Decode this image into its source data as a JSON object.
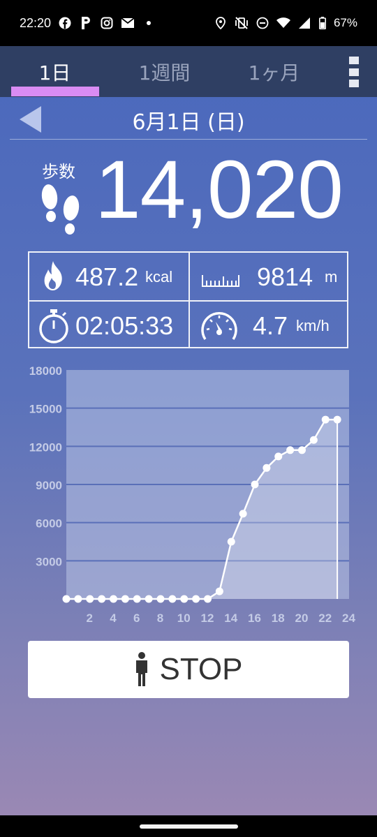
{
  "status_bar": {
    "time": "22:20",
    "battery": "67%",
    "left_icons": [
      "facebook-icon",
      "parking-icon",
      "instagram-icon",
      "mail-icon",
      "dot-icon"
    ],
    "right_icons": [
      "location-icon",
      "vibrate-off-icon",
      "dnd-icon",
      "wifi-icon",
      "signal-icon",
      "battery-icon"
    ]
  },
  "tabs": [
    {
      "label": "1日",
      "active": true
    },
    {
      "label": "1週間",
      "active": false
    },
    {
      "label": "1ヶ月",
      "active": false
    }
  ],
  "date_label": "6月1日 (日)",
  "steps": {
    "label": "歩数",
    "value": "14,020"
  },
  "stats": {
    "calories": {
      "value": "487.2",
      "unit": "kcal"
    },
    "distance": {
      "value": "9814",
      "unit": "m"
    },
    "time": {
      "value": "02:05:33"
    },
    "speed": {
      "value": "4.7",
      "unit": "km/h"
    }
  },
  "chart_data": {
    "type": "area",
    "title": "",
    "xlabel": "",
    "ylabel": "",
    "xlim": [
      0,
      24
    ],
    "ylim": [
      0,
      18000
    ],
    "x_ticks": [
      2,
      4,
      6,
      8,
      10,
      12,
      14,
      16,
      18,
      20,
      22,
      24
    ],
    "y_ticks": [
      3000,
      6000,
      9000,
      12000,
      15000,
      18000
    ],
    "grid": true,
    "x": [
      0,
      1,
      2,
      3,
      4,
      5,
      6,
      7,
      8,
      9,
      10,
      11,
      12,
      13,
      14,
      15,
      16,
      17,
      18,
      19,
      20,
      21,
      22,
      23
    ],
    "values": [
      0,
      0,
      0,
      0,
      0,
      0,
      0,
      0,
      0,
      0,
      0,
      0,
      0,
      600,
      4500,
      6700,
      9000,
      10300,
      11200,
      11700,
      11700,
      12500,
      14100,
      14100
    ]
  },
  "stop_button": {
    "label": "STOP"
  },
  "colors": {
    "tab_indicator": "#d98cf3",
    "tabbar": "#2f3f63",
    "chart_line": "#ffffff",
    "grid_line": "#5a6fb8"
  }
}
